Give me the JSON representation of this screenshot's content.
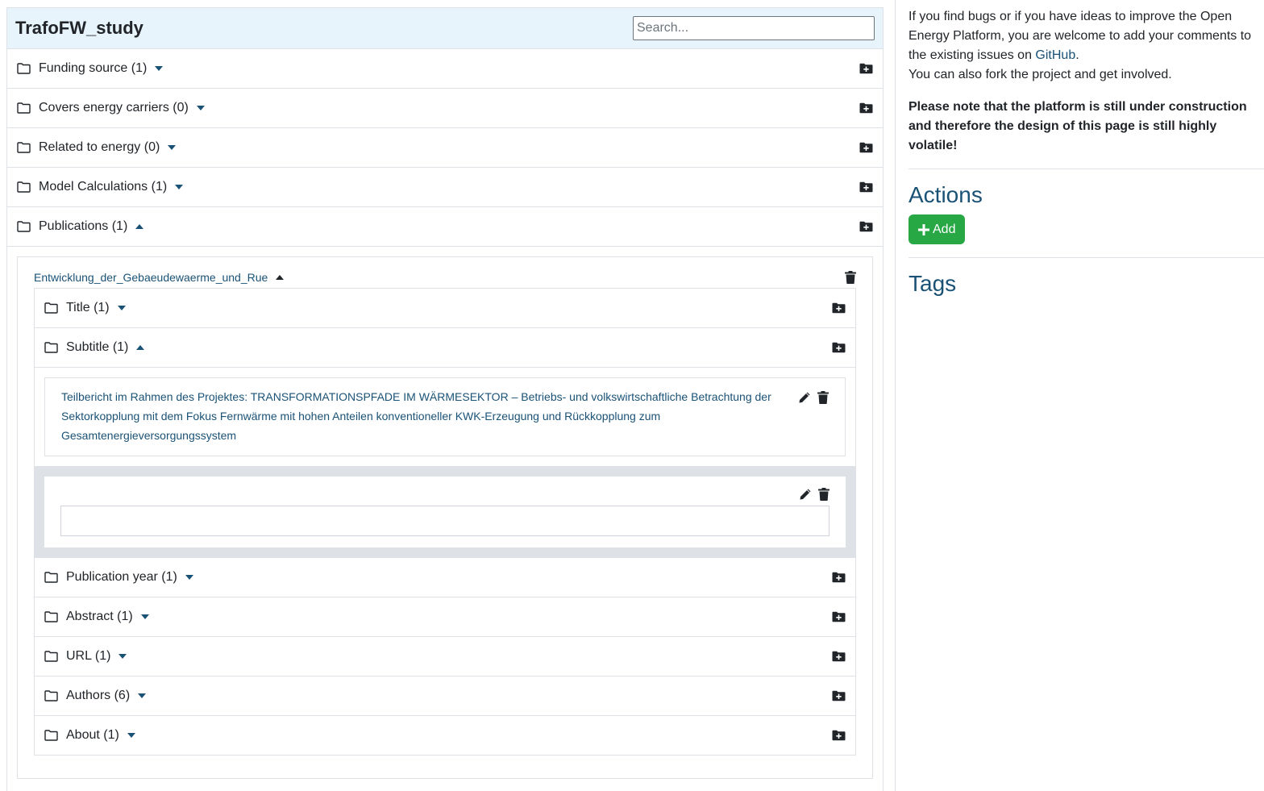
{
  "header": {
    "title": "TrafoFW_study",
    "search_placeholder": "Search..."
  },
  "top_rows": [
    {
      "label": "Funding source (1)",
      "expanded": false
    },
    {
      "label": "Covers energy carriers (0)",
      "expanded": false
    },
    {
      "label": "Related to energy (0)",
      "expanded": false
    },
    {
      "label": "Model Calculations (1)",
      "expanded": false
    },
    {
      "label": "Publications (1)",
      "expanded": true
    }
  ],
  "publication": {
    "name": "Entwicklung_der_Gebaeudewaerme_und_Rue",
    "rows_before": [
      {
        "label": "Title (1)",
        "expanded": false
      },
      {
        "label": "Subtitle (1)",
        "expanded": true
      }
    ],
    "subtitle_value": "Teilbericht im Rahmen des Projektes: TRANSFORMATIONSPFADE IM WÄRMESEKTOR – Betriebs- und volkswirtschaftliche Betrachtung der Sektorkopplung mit dem Fokus Fernwärme mit hohen Anteilen konventioneller KWK-Erzeugung und Rückkopplung zum Gesamtenergieversorgungssystem",
    "edit_value": "",
    "rows_after": [
      {
        "label": "Publication year (1)",
        "expanded": false
      },
      {
        "label": "Abstract (1)",
        "expanded": false
      },
      {
        "label": "URL (1)",
        "expanded": false
      },
      {
        "label": "Authors (6)",
        "expanded": false
      },
      {
        "label": "About (1)",
        "expanded": false
      }
    ]
  },
  "sidebar": {
    "intro_before_link": "If you find bugs or if you have ideas to improve the Open Energy Platform, you are welcome to add your comments to the existing issues on ",
    "link_text": "GitHub",
    "intro_after_link": ".",
    "intro_line2": "You can also fork the project and get involved.",
    "note": "Please note that the platform is still under construction and therefore the design of this page is still highly volatile!",
    "actions_heading": "Actions",
    "add_button_label": "Add",
    "tags_heading": "Tags"
  },
  "colors": {
    "accent": "#1a5276",
    "header_bg": "#e8f4fc",
    "add_button": "#28a745",
    "edit_bg": "#dee2e6"
  },
  "icons": {
    "folder": "folder-icon",
    "add_folder": "folder-plus-icon",
    "trash": "trash-icon",
    "pencil": "pencil-icon",
    "caret_down": "caret-down-icon",
    "caret_up": "caret-up-icon",
    "plus": "plus-icon"
  }
}
